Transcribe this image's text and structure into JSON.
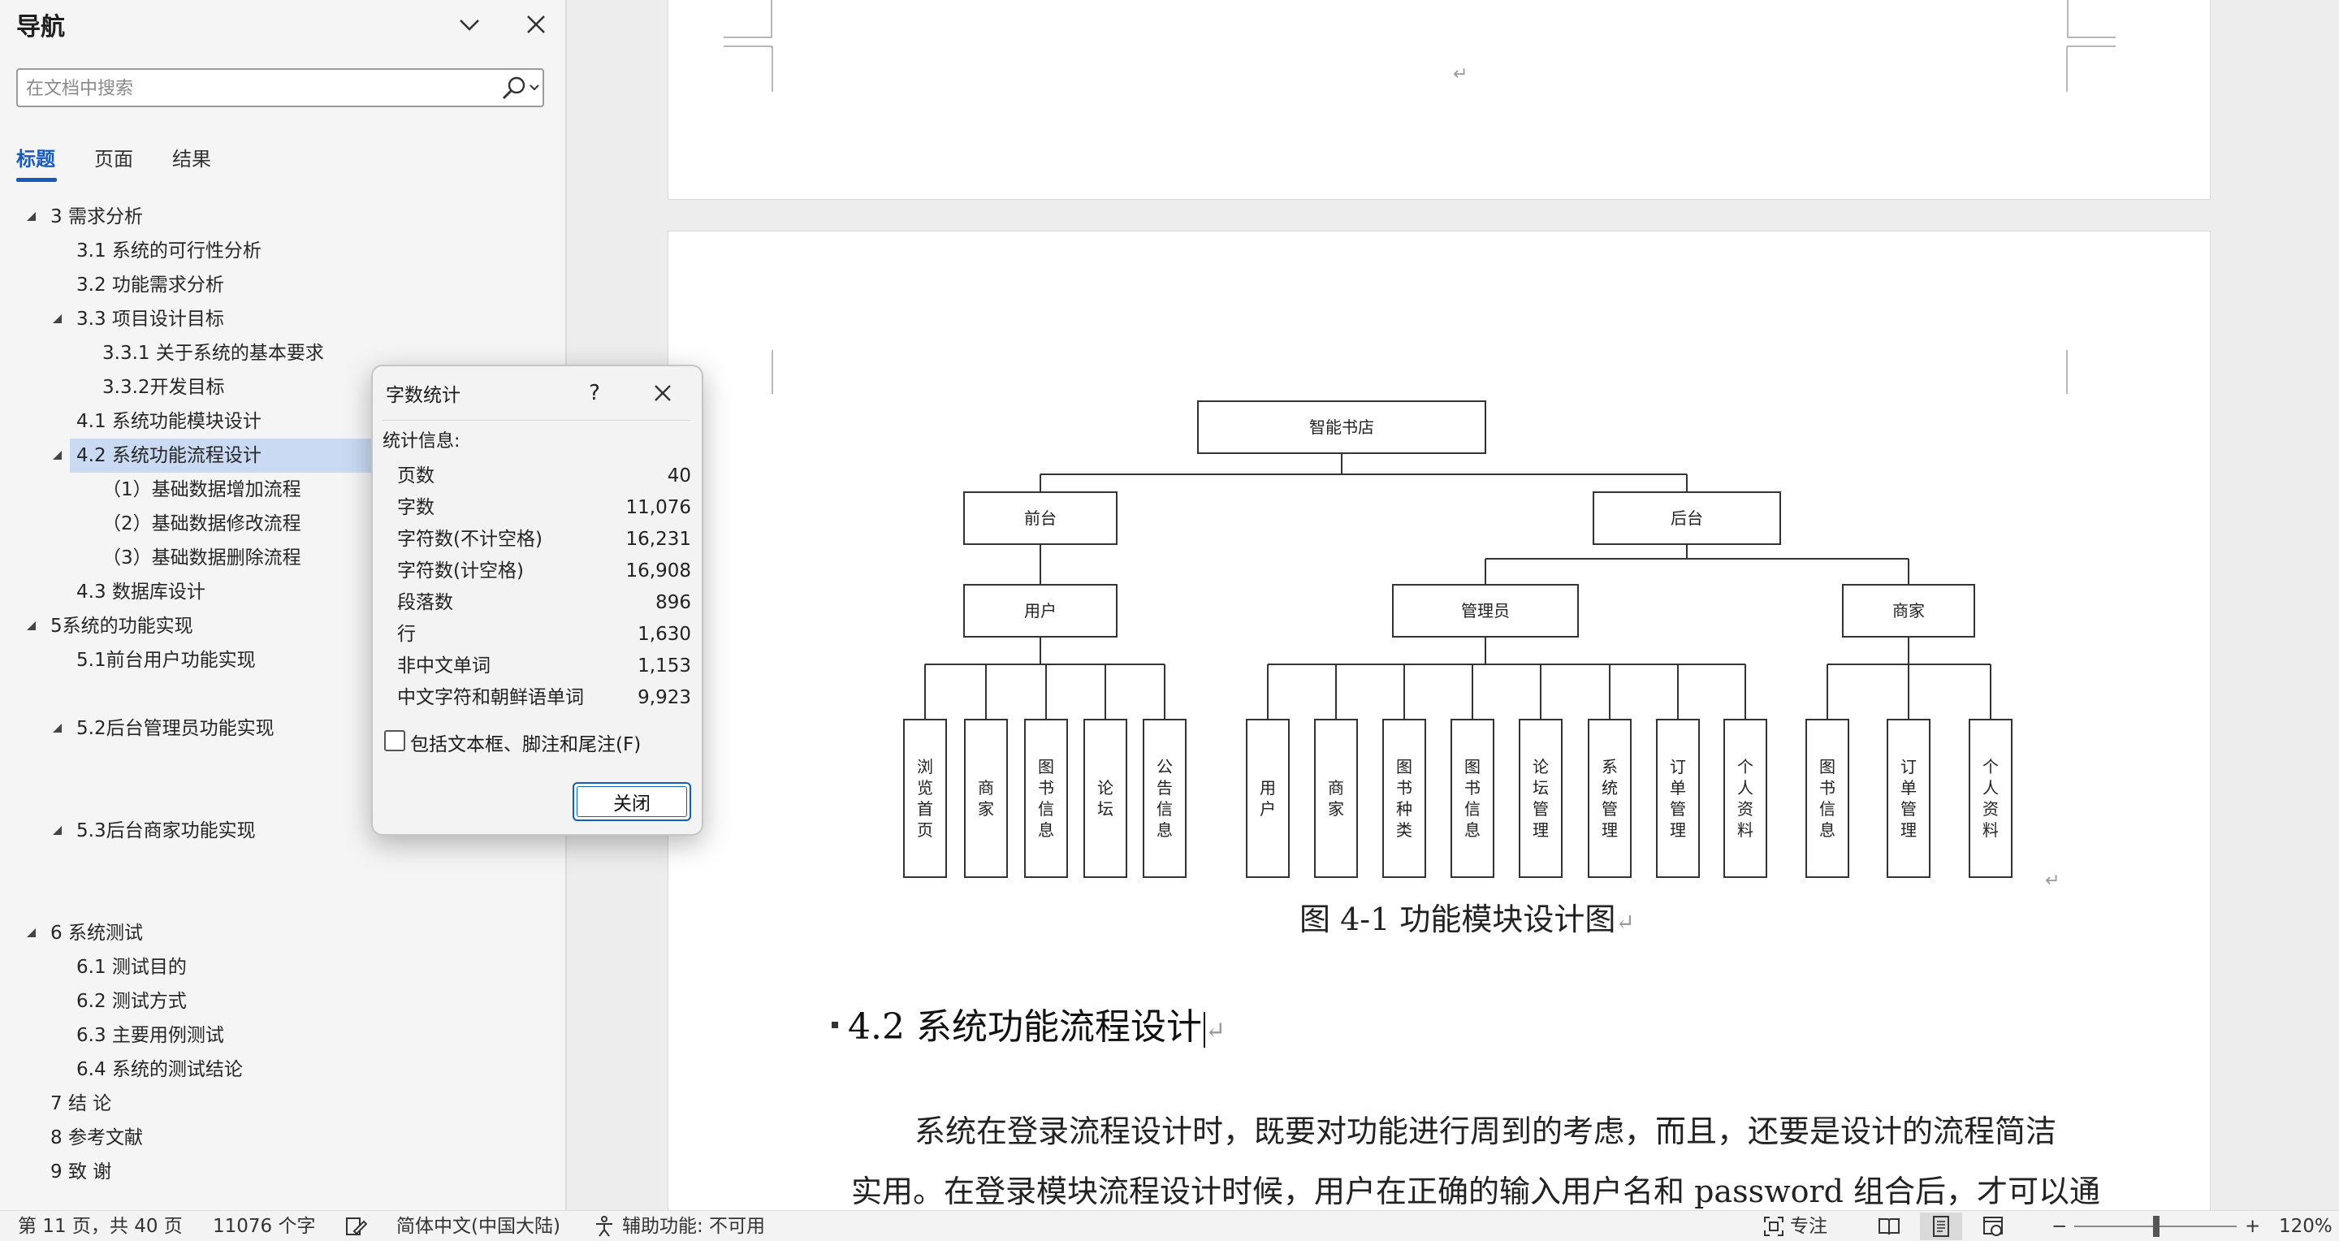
{
  "navigation": {
    "title": "导航",
    "search_placeholder": "在文档中搜索",
    "tabs": [
      {
        "label": "标题",
        "active": true
      },
      {
        "label": "页面",
        "active": false
      },
      {
        "label": "结果",
        "active": false
      }
    ],
    "outline": [
      {
        "text": "3 需求分析",
        "level": 0,
        "expandable": true
      },
      {
        "text": "3.1 系统的可行性分析",
        "level": 1,
        "expandable": false
      },
      {
        "text": "3.2 功能需求分析",
        "level": 1,
        "expandable": false
      },
      {
        "text": "3.3 项目设计目标",
        "level": 1,
        "expandable": true
      },
      {
        "text": "3.3.1 关于系统的基本要求",
        "level": 2,
        "expandable": false
      },
      {
        "text": "3.3.2开发目标",
        "level": 2,
        "expandable": false
      },
      {
        "text": "4.1 系统功能模块设计",
        "level": 1,
        "expandable": false
      },
      {
        "text": "4.2 系统功能流程设计",
        "level": 1,
        "expandable": true,
        "selected": true
      },
      {
        "text": "（1）基础数据增加流程",
        "level": 2,
        "expandable": false
      },
      {
        "text": "（2）基础数据修改流程",
        "level": 2,
        "expandable": false
      },
      {
        "text": "（3）基础数据删除流程",
        "level": 2,
        "expandable": false
      },
      {
        "text": "4.3 数据库设计",
        "level": 1,
        "expandable": false
      },
      {
        "text": "5系统的功能实现",
        "level": 0,
        "expandable": true
      },
      {
        "text": "5.1前台用户功能实现",
        "level": 1,
        "expandable": false
      },
      {
        "text": "5.2后台管理员功能实现",
        "level": 1,
        "expandable": true
      },
      {
        "text": "5.3后台商家功能实现",
        "level": 1,
        "expandable": true
      },
      {
        "text": " 6 系统测试",
        "level": 0,
        "expandable": true
      },
      {
        "text": "6.1  测试目的",
        "level": 1,
        "expandable": false
      },
      {
        "text": "6.2  测试方式",
        "level": 1,
        "expandable": false
      },
      {
        "text": "6.3 主要用例测试",
        "level": 1,
        "expandable": false
      },
      {
        "text": "6.4 系统的测试结论",
        "level": 1,
        "expandable": false
      },
      {
        "text": "7 结 论",
        "level": 0,
        "expandable": false
      },
      {
        "text": "8 参考文献",
        "level": 0,
        "expandable": false
      },
      {
        "text": "9 致 谢",
        "level": 0,
        "expandable": false
      }
    ]
  },
  "word_count_dialog": {
    "title": "字数统计",
    "help_label": "?",
    "section_label": "统计信息:",
    "stats": [
      {
        "label": "页数",
        "value": "40"
      },
      {
        "label": "字数",
        "value": "11,076"
      },
      {
        "label": "字符数(不计空格)",
        "value": "16,231"
      },
      {
        "label": "字符数(计空格)",
        "value": "16,908"
      },
      {
        "label": "段落数",
        "value": "896"
      },
      {
        "label": "行",
        "value": "1,630"
      },
      {
        "label": "非中文单词",
        "value": "1,153"
      },
      {
        "label": "中文字符和朝鲜语单词",
        "value": "9,923"
      }
    ],
    "checkbox_label": "包括文本框、脚注和尾注(F)",
    "checkbox_checked": false,
    "close_label": "关闭"
  },
  "document": {
    "diagram": {
      "root": "智能书店",
      "front": "前台",
      "back": "后台",
      "user": "用户",
      "admin": "管理员",
      "merchant": "商家",
      "user_leaves": [
        "浏览首页",
        "商家",
        "图书信息",
        "论坛",
        "公告信息"
      ],
      "admin_leaves": [
        "用户",
        "商家",
        "图书种类",
        "图书信息",
        "论坛管理",
        "系统管理",
        "订单管理",
        "个人资料"
      ],
      "merchant_leaves": [
        "图书信息",
        "订单管理",
        "个人资料"
      ]
    },
    "caption": "图 4-1  功能模块设计图",
    "heading": "4.2  系统功能流程设计",
    "body_lines": [
      "系统在登录流程设计时，既要对功能进行周到的考虑，而且，还要是设计的流程简洁",
      "实用。在登录模块流程设计时候，用户在正确的输入用户名和 password 组合后，才可以通"
    ]
  },
  "status_bar": {
    "page_info": "第 11 页，共 40 页",
    "word_count": "11076 个字",
    "language": "简体中文(中国大陆)",
    "accessibility": "辅助功能: 不可用",
    "focus": "专注",
    "zoom_minus": "−",
    "zoom_plus": "+",
    "zoom": "120%"
  },
  "colors": {
    "accent": "#185abd",
    "selection": "#c9daf2"
  }
}
